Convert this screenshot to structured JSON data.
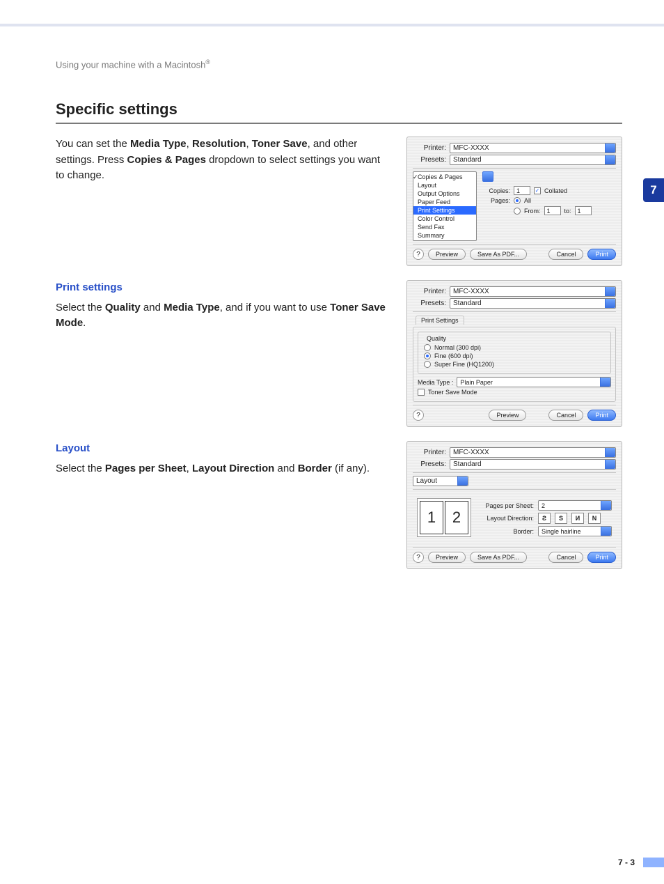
{
  "breadcrumb": "Using your machine with a Macintosh",
  "breadcrumb_mark": "®",
  "heading": "Specific settings",
  "intro": {
    "t1": "You can set the ",
    "b1": "Media Type",
    "c1": ", ",
    "b2": "Resolution",
    "c2": ", ",
    "b3": "Toner Save",
    "t2": ", and other settings. Press ",
    "b4": "Copies & Pages",
    "t3": " dropdown to select settings you want to change."
  },
  "section_print": {
    "title": "Print settings",
    "t1": "Select the ",
    "b1": "Quality",
    "t2": " and ",
    "b2": "Media Type",
    "t3": ", and if you want to use ",
    "b3": "Toner Save Mode",
    "t4": "."
  },
  "section_layout": {
    "title": "Layout",
    "t1": "Select the ",
    "b1": "Pages per Sheet",
    "c1": ", ",
    "b2": "Layout Direction",
    "t2": " and ",
    "b3": "Border",
    "t3": " (if any)."
  },
  "chapter": "7",
  "page_number": "7 - 3",
  "dlg1": {
    "printer_lbl": "Printer:",
    "printer": "MFC-XXXX",
    "presets_lbl": "Presets:",
    "presets": "Standard",
    "menu": [
      "Copies & Pages",
      "Layout",
      "Output Options",
      "Paper Feed",
      "Print Settings",
      "Color Control",
      "Send Fax",
      "Summary"
    ],
    "copies_lbl": "Copies:",
    "copies": "1",
    "collated": "Collated",
    "pages_lbl": "Pages:",
    "all": "All",
    "from_lbl": "From:",
    "from": "1",
    "to_lbl": "to:",
    "to": "1",
    "preview": "Preview",
    "save_pdf": "Save As PDF...",
    "cancel": "Cancel",
    "print": "Print",
    "help": "?"
  },
  "dlg2": {
    "printer_lbl": "Printer:",
    "printer": "MFC-XXXX",
    "presets_lbl": "Presets:",
    "presets": "Standard",
    "tab": "Print Settings",
    "quality_legend": "Quality",
    "q_normal": "Normal (300 dpi)",
    "q_fine": "Fine (600 dpi)",
    "q_super": "Super Fine (HQ1200)",
    "media_lbl": "Media Type :",
    "media": "Plain Paper",
    "toner_save": "Toner Save Mode",
    "preview": "Preview",
    "cancel": "Cancel",
    "print": "Print",
    "help": "?"
  },
  "dlg3": {
    "printer_lbl": "Printer:",
    "printer": "MFC-XXXX",
    "presets_lbl": "Presets:",
    "presets": "Standard",
    "tab": "Layout",
    "preview1": "1",
    "preview2": "2",
    "pps_lbl": "Pages per Sheet:",
    "pps": "2",
    "dir_lbl": "Layout Direction:",
    "d1": "Ƨ",
    "d2": "S",
    "d3": "И",
    "d4": "N",
    "border_lbl": "Border:",
    "border": "Single hairline",
    "preview": "Preview",
    "save_pdf": "Save As PDF...",
    "cancel": "Cancel",
    "print": "Print",
    "help": "?"
  }
}
